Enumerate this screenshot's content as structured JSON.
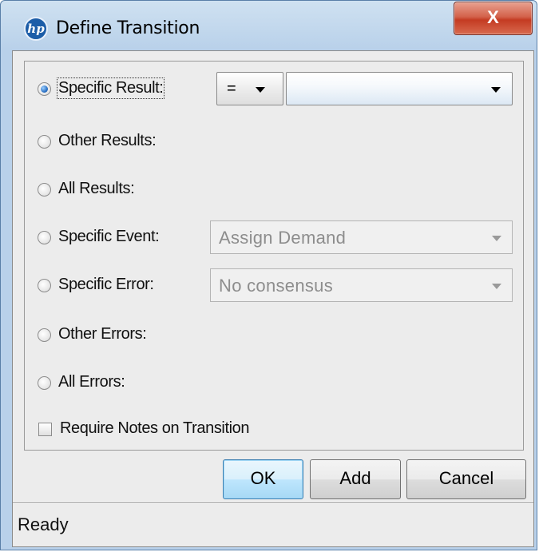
{
  "window": {
    "title": "Define Transition",
    "app_icon_text": "hp",
    "close_symbol": "X"
  },
  "options": {
    "specific_result": {
      "label": "Specific Result:",
      "selected": true
    },
    "operator": {
      "value": "=",
      "icon": "dropdown-arrow"
    },
    "result_value": {
      "value": "",
      "icon": "dropdown-arrow"
    },
    "other_results": {
      "label": "Other Results:",
      "selected": false
    },
    "all_results": {
      "label": "All Results:",
      "selected": false
    },
    "specific_event": {
      "label": "Specific Event:",
      "selected": false,
      "value": "Assign Demand",
      "enabled": false
    },
    "specific_error": {
      "label": "Specific Error:",
      "selected": false,
      "value": "No consensus",
      "enabled": false
    },
    "other_errors": {
      "label": "Other Errors:",
      "selected": false
    },
    "all_errors": {
      "label": "All Errors:",
      "selected": false
    },
    "require_notes": {
      "label": "Require Notes on Transition",
      "checked": false
    }
  },
  "buttons": {
    "ok": "OK",
    "add": "Add",
    "cancel": "Cancel"
  },
  "status": {
    "text": "Ready"
  },
  "colors": {
    "title_gradient": "#cfe1f1",
    "close_button": "#c43b22",
    "default_button": "#bee6fd",
    "radio_selected": "#2e74c6"
  }
}
